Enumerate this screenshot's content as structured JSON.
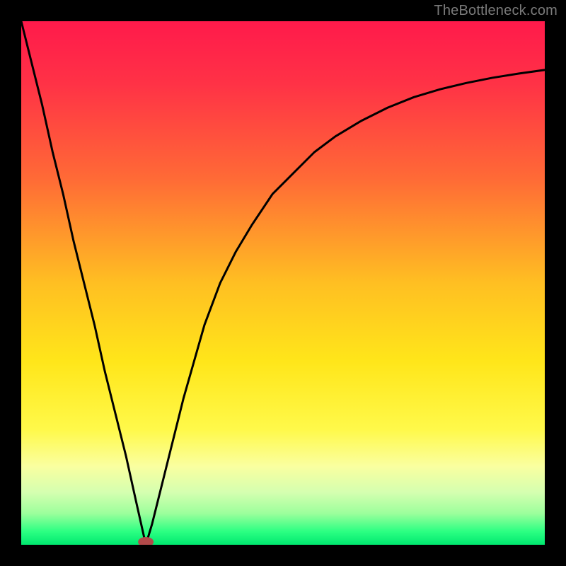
{
  "watermark": "TheBottleneck.com",
  "chart_data": {
    "type": "line",
    "title": "",
    "xlabel": "",
    "ylabel": "",
    "xlim": [
      0,
      100
    ],
    "ylim": [
      0,
      100
    ],
    "series": [
      {
        "name": "bottleneck-curve",
        "x": [
          0,
          2,
          4,
          6,
          8,
          10,
          12,
          14,
          16,
          18,
          20,
          22,
          23.8,
          25,
          27,
          29,
          31,
          33,
          35,
          38,
          41,
          44,
          48,
          52,
          56,
          60,
          65,
          70,
          75,
          80,
          85,
          90,
          95,
          100
        ],
        "y": [
          100,
          92,
          84,
          75,
          67,
          58,
          50,
          42,
          33,
          25,
          17,
          8,
          0,
          4,
          12,
          20,
          28,
          35,
          42,
          50,
          56,
          61,
          67,
          71,
          75,
          78,
          81,
          83.5,
          85.5,
          87,
          88.2,
          89.2,
          90,
          90.7
        ]
      }
    ],
    "marker": {
      "x": 23.8,
      "y": 0,
      "color": "#b24a4a"
    },
    "gradient_stops": [
      {
        "offset": 0.0,
        "color": "#ff1a4b"
      },
      {
        "offset": 0.12,
        "color": "#ff3246"
      },
      {
        "offset": 0.3,
        "color": "#ff6a36"
      },
      {
        "offset": 0.5,
        "color": "#ffbf22"
      },
      {
        "offset": 0.65,
        "color": "#ffe61a"
      },
      {
        "offset": 0.78,
        "color": "#fff94a"
      },
      {
        "offset": 0.85,
        "color": "#faffa0"
      },
      {
        "offset": 0.9,
        "color": "#d5ffb0"
      },
      {
        "offset": 0.94,
        "color": "#9cff9c"
      },
      {
        "offset": 0.975,
        "color": "#2bff82"
      },
      {
        "offset": 1.0,
        "color": "#00e86f"
      }
    ],
    "curve_stroke": "#000000",
    "curve_width": 3
  }
}
